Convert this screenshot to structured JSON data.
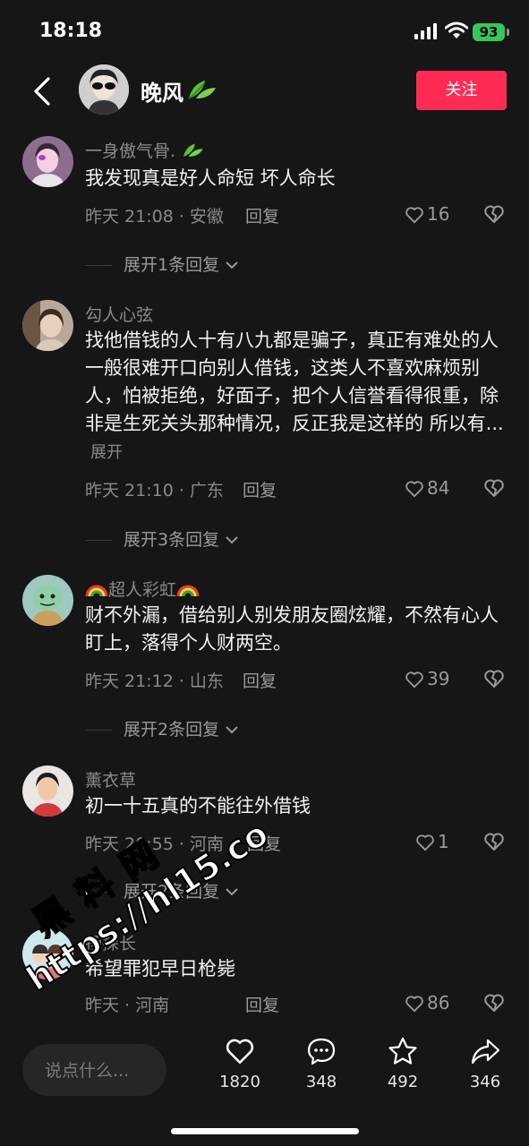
{
  "status": {
    "time": "18:18",
    "battery": "93"
  },
  "header": {
    "name": "晚风",
    "follow_label": "关注"
  },
  "comments": [
    {
      "name": "一身傲气骨.",
      "text": "我发现真是好人命短  坏人命长",
      "more": "",
      "time": "昨天 21:08 · 安徽",
      "reply": "回复",
      "likes": "16",
      "expand": "展开1条回复"
    },
    {
      "name": "勾人心弦",
      "text": "找他借钱的人十有八九都是骗子，真正有难处的人一般很难开口向别人借钱，这类人不喜欢麻烦别人，怕被拒绝，好面子，把个人信誉看得很重，除非是生死关头那种情况，反正我是这样的 所以有...",
      "more": "展开",
      "time": "昨天 21:10 · 广东",
      "reply": "回复",
      "likes": "84",
      "expand": "展开3条回复"
    },
    {
      "name": "超人彩虹",
      "text": "财不外漏，借给别人别发朋友圈炫耀，不然有心人盯上，落得个人财两空。",
      "more": "",
      "time": "昨天 21:12 · 山东",
      "reply": "回复",
      "likes": "39",
      "expand": "展开2条回复"
    },
    {
      "name": "薰衣草",
      "text": "初一十五真的不能往外借钱",
      "more": "",
      "time": "昨天 20:55 · 河南",
      "reply": "回复",
      "likes": "1",
      "expand": "展开2条回复"
    },
    {
      "name": "扬探长",
      "text": "希望罪犯早日枪毙",
      "more": "",
      "time": "昨天 · 河南",
      "reply": "回复",
      "likes": "86",
      "expand": ""
    }
  ],
  "bottom": {
    "input_placeholder": "说点什么...",
    "likes": "1820",
    "comments": "348",
    "favorites": "492",
    "shares": "346"
  },
  "watermark": {
    "line1": "黑料网",
    "line2": "https://hl15.co"
  },
  "icons": {
    "back": "chevron-left-icon",
    "like": "heart-icon",
    "dislike": "broken-heart-icon",
    "comment": "chat-bubble-icon",
    "favorite": "star-icon",
    "share": "share-arrow-icon"
  },
  "colors": {
    "accent": "#fe2c55",
    "background": "#161616",
    "battery": "#34c759"
  }
}
